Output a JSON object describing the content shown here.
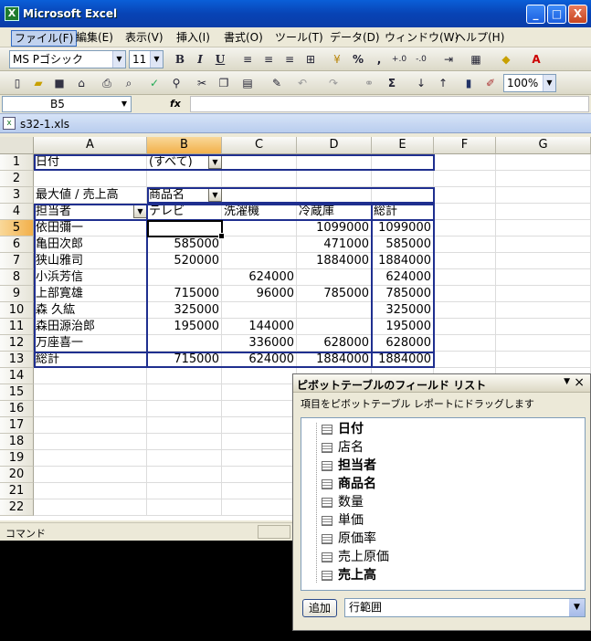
{
  "window": {
    "title": "Microsoft Excel",
    "minimize": "_",
    "maximize": "□",
    "close": "X"
  },
  "menu": [
    "ファイル(F)",
    "編集(E)",
    "表示(V)",
    "挿入(I)",
    "書式(O)",
    "ツール(T)",
    "データ(D)",
    "ウィンドウ(W)",
    "ヘルプ(H)"
  ],
  "format_toolbar": {
    "font": "MS Pゴシック",
    "size": "11",
    "bold": "B",
    "italic": "I",
    "underline": "U",
    "percent": "%",
    "comma": ","
  },
  "standard_toolbar": {
    "sigma": "Σ",
    "zoom": "100%"
  },
  "formula_bar": {
    "cell_ref": "B5",
    "fx": "fx"
  },
  "workbook": {
    "name": "s32-1.xls"
  },
  "columns": [
    "A",
    "B",
    "C",
    "D",
    "E",
    "F",
    "G"
  ],
  "selected_column": "B",
  "rows": [
    {
      "n": "1",
      "cells": [
        "日付",
        "(すべて)",
        "",
        "",
        "",
        "",
        ""
      ]
    },
    {
      "n": "2",
      "cells": [
        "",
        "",
        "",
        "",
        "",
        "",
        ""
      ]
    },
    {
      "n": "3",
      "cells": [
        "最大値 / 売上高",
        "商品名",
        "",
        "",
        "",
        "",
        ""
      ]
    },
    {
      "n": "4",
      "cells": [
        "担当者",
        "テレビ",
        "洗濯機",
        "冷蔵庫",
        "総計",
        "",
        ""
      ]
    },
    {
      "n": "5",
      "cells": [
        "依田彌一",
        "",
        "",
        "1099000",
        "1099000",
        "",
        ""
      ]
    },
    {
      "n": "6",
      "cells": [
        "亀田次郎",
        "585000",
        "",
        "471000",
        "585000",
        "",
        ""
      ]
    },
    {
      "n": "7",
      "cells": [
        "狭山雅司",
        "520000",
        "",
        "1884000",
        "1884000",
        "",
        ""
      ]
    },
    {
      "n": "8",
      "cells": [
        "小浜芳信",
        "",
        "624000",
        "",
        "624000",
        "",
        ""
      ]
    },
    {
      "n": "9",
      "cells": [
        "上部寛雄",
        "715000",
        "96000",
        "785000",
        "785000",
        "",
        ""
      ]
    },
    {
      "n": "10",
      "cells": [
        "森 久紘",
        "325000",
        "",
        "",
        "325000",
        "",
        ""
      ]
    },
    {
      "n": "11",
      "cells": [
        "森田源治郎",
        "195000",
        "144000",
        "",
        "195000",
        "",
        ""
      ]
    },
    {
      "n": "12",
      "cells": [
        "万座喜一",
        "",
        "336000",
        "628000",
        "628000",
        "",
        ""
      ]
    },
    {
      "n": "13",
      "cells": [
        "総計",
        "715000",
        "624000",
        "1884000",
        "1884000",
        "",
        ""
      ]
    },
    {
      "n": "14",
      "cells": [
        "",
        "",
        "",
        "",
        "",
        "",
        ""
      ]
    },
    {
      "n": "15",
      "cells": [
        "",
        "",
        "",
        "",
        "",
        "",
        ""
      ]
    },
    {
      "n": "16",
      "cells": [
        "",
        "",
        "",
        "",
        "",
        "",
        ""
      ]
    },
    {
      "n": "17",
      "cells": [
        "",
        "",
        "",
        "",
        "",
        "",
        ""
      ]
    },
    {
      "n": "18",
      "cells": [
        "",
        "",
        "",
        "",
        "",
        "",
        ""
      ]
    },
    {
      "n": "19",
      "cells": [
        "",
        "",
        "",
        "",
        "",
        "",
        ""
      ]
    },
    {
      "n": "20",
      "cells": [
        "",
        "",
        "",
        "",
        "",
        "",
        ""
      ]
    },
    {
      "n": "21",
      "cells": [
        "",
        "",
        "",
        "",
        "",
        "",
        ""
      ]
    },
    {
      "n": "22",
      "cells": [
        "",
        "",
        "",
        "",
        "",
        "",
        ""
      ]
    }
  ],
  "selected_row": "5",
  "status": {
    "text": "コマンド"
  },
  "pivot_field_list": {
    "title": "ピボットテーブルのフィールド リスト",
    "description": "項目をピボットテーブル レポートにドラッグします",
    "fields": [
      {
        "label": "日付",
        "bold": true
      },
      {
        "label": "店名",
        "bold": false
      },
      {
        "label": "担当者",
        "bold": true
      },
      {
        "label": "商品名",
        "bold": true
      },
      {
        "label": "数量",
        "bold": false
      },
      {
        "label": "単価",
        "bold": false
      },
      {
        "label": "原価率",
        "bold": false
      },
      {
        "label": "売上原価",
        "bold": false
      },
      {
        "label": "売上高",
        "bold": true
      }
    ],
    "add_button": "追加",
    "area_select": "行範囲"
  }
}
